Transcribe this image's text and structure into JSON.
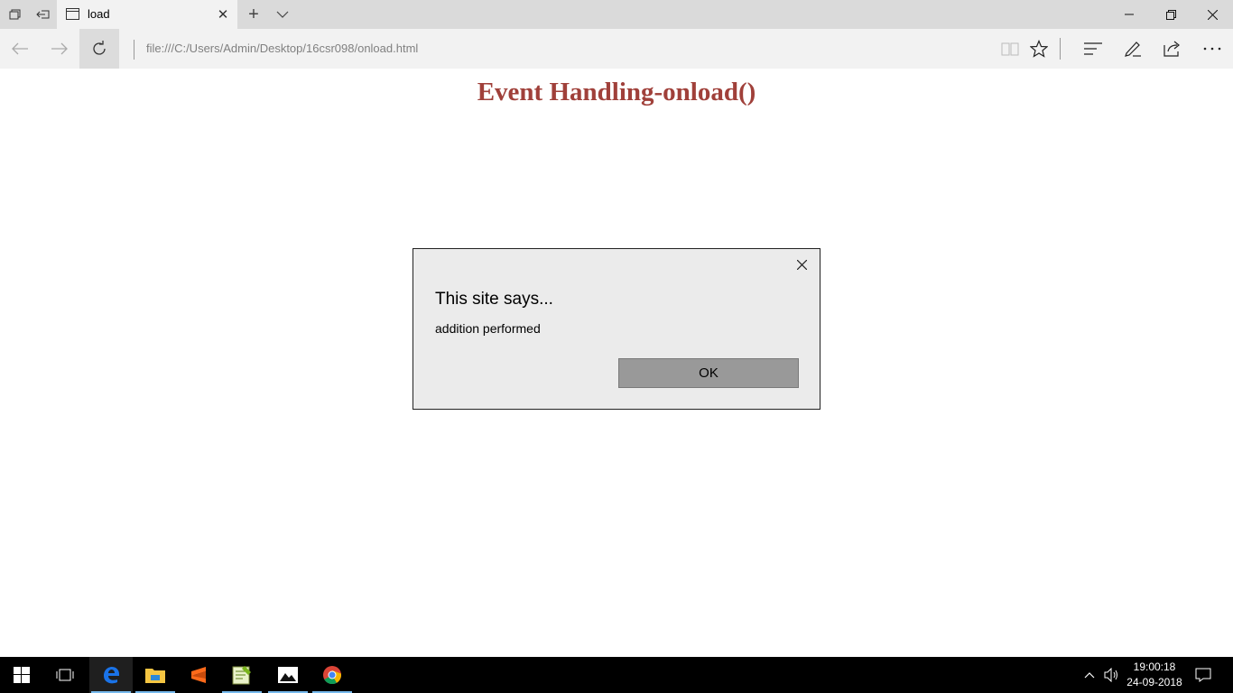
{
  "browser": {
    "tab_title": "load",
    "address": "file:///C:/Users/Admin/Desktop/16csr098/onload.html"
  },
  "page": {
    "heading": "Event Handling-onload()"
  },
  "dialog": {
    "title": "This site says...",
    "message": "addition performed",
    "ok_label": "OK"
  },
  "taskbar": {
    "apps": [
      "edge",
      "file-explorer",
      "sublime-text",
      "notepad-plus-plus",
      "photos",
      "chrome"
    ],
    "time": "19:00:18",
    "date": "24-09-2018"
  }
}
